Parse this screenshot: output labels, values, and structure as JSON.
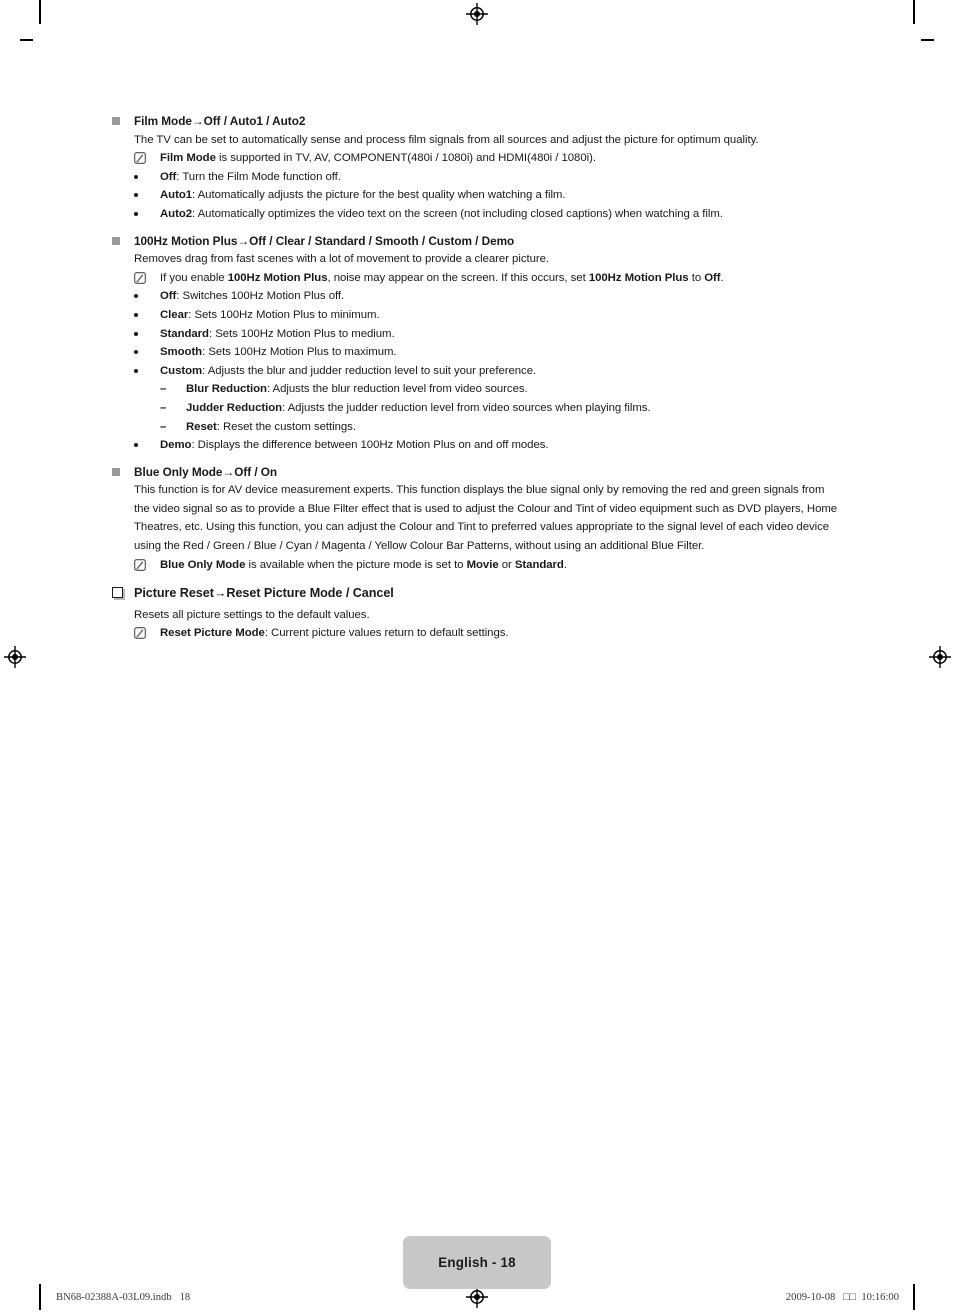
{
  "document": {
    "page_badge": "English - 18",
    "slug_left": "BN68-02388A-03L09.indb   18",
    "slug_right": "2009-10-08   □□  10:16:00"
  },
  "sections": [
    {
      "id": "film-mode",
      "marker": "gray-square",
      "heading_plain": "Film Mode",
      "heading_arrow": "→",
      "heading_values": "Off / Auto1 / Auto2",
      "paragraph": "The TV can be set to automatically sense and process film signals from all sources and adjust the picture for optimum quality.",
      "note": {
        "bold_lead": "Film Mode",
        "rest": " is supported in TV, AV, COMPONENT(480i / 1080i) and HDMI(480i / 1080i)."
      },
      "bullets": [
        {
          "term": "Off",
          "desc": ": Turn the Film Mode function off."
        },
        {
          "term": "Auto1",
          "desc": ": Automatically adjusts the picture for the best quality when watching a film."
        },
        {
          "term": "Auto2",
          "desc": ": Automatically optimizes the video text on the screen (not including closed captions) when watching a film."
        }
      ]
    },
    {
      "id": "motion-plus",
      "marker": "gray-square",
      "heading_plain": "100Hz Motion Plus",
      "heading_arrow": "→",
      "heading_values": "Off / Clear / Standard / Smooth / Custom / Demo",
      "paragraph": "Removes drag from fast scenes with a lot of movement to provide a clearer picture.",
      "note_parts": [
        {
          "text": "If you enable ",
          "bold": false
        },
        {
          "text": "100Hz Motion Plus",
          "bold": true
        },
        {
          "text": ", noise may appear on the screen. If this occurs, set ",
          "bold": false
        },
        {
          "text": "100Hz Motion Plus",
          "bold": true
        },
        {
          "text": " to ",
          "bold": false
        },
        {
          "text": "Off",
          "bold": true
        },
        {
          "text": ".",
          "bold": false
        }
      ],
      "bullets": [
        {
          "term": "Off",
          "desc": ": Switches 100Hz Motion Plus off."
        },
        {
          "term": "Clear",
          "desc": ": Sets 100Hz Motion Plus to minimum."
        },
        {
          "term": "Standard",
          "desc": ": Sets 100Hz Motion Plus to medium."
        },
        {
          "term": "Smooth",
          "desc": ": Sets 100Hz Motion Plus to maximum."
        },
        {
          "term": "Custom",
          "desc": ": Adjusts the blur and judder reduction level to suit your preference."
        }
      ],
      "sub_bullets": [
        {
          "term": "Blur Reduction",
          "desc": ": Adjusts the blur reduction level from video sources."
        },
        {
          "term": "Judder Reduction",
          "desc": ": Adjusts the judder reduction level from video sources when playing films."
        },
        {
          "term": "Reset",
          "desc": ": Reset the custom settings."
        }
      ],
      "last_bullet": {
        "term": "Demo",
        "desc": ": Displays the difference between 100Hz Motion Plus on and off modes."
      }
    },
    {
      "id": "blue-only-mode",
      "marker": "gray-square",
      "heading_plain": "Blue Only Mode",
      "heading_arrow": "→",
      "heading_values": "Off / On",
      "paragraph": "This function is for AV device measurement experts. This function displays the blue signal only by removing the red and green signals from the video signal so as to provide a Blue Filter effect that is used to adjust the Colour and Tint of video equipment such as DVD players, Home Theatres, etc. Using this function, you can adjust the Colour and Tint to preferred values appropriate to the signal level of each video device using the Red / Green / Blue / Cyan / Magenta / Yellow Colour Bar Patterns, without using an additional Blue Filter.",
      "note_parts": [
        {
          "text": "Blue Only Mode",
          "bold": true
        },
        {
          "text": " is available when the picture mode is set to ",
          "bold": false
        },
        {
          "text": "Movie",
          "bold": true
        },
        {
          "text": " or ",
          "bold": false
        },
        {
          "text": "Standard",
          "bold": true
        },
        {
          "text": ".",
          "bold": false
        }
      ]
    },
    {
      "id": "picture-reset",
      "marker": "hollow-square",
      "heading_plain": "Picture Reset",
      "heading_arrow": "→",
      "heading_values": "Reset Picture Mode / Cancel",
      "paragraph": "Resets all picture settings to the default values.",
      "note": {
        "bold_lead": "Reset Picture Mode",
        "rest": ": Current picture values return to default settings."
      }
    }
  ],
  "icons": {
    "note": "note-pencil-icon",
    "bullet": "round-bullet-icon",
    "dash": "–",
    "gray_square": "gray-square-bullet-icon",
    "hollow_square": "hollow-square-bullet-icon",
    "registration": "registration-target-icon"
  }
}
